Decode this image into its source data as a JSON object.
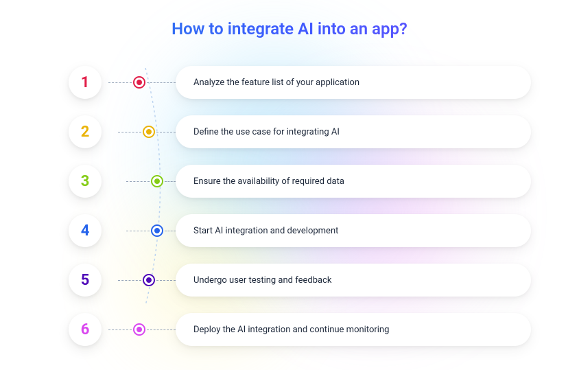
{
  "title": "How to integrate AI into an app?",
  "steps": [
    {
      "num": "1",
      "text": "Analyze the feature list of your application",
      "color": "#e11d48"
    },
    {
      "num": "2",
      "text": "Define the use case for integrating AI",
      "color": "#eab308"
    },
    {
      "num": "3",
      "text": "Ensure the availability of required data",
      "color": "#84cc16"
    },
    {
      "num": "4",
      "text": "Start AI integration and development",
      "color": "#2563eb"
    },
    {
      "num": "5",
      "text": "Undergo user testing and feedback",
      "color": "#4f0ab8"
    },
    {
      "num": "6",
      "text": "Deploy the AI integration and continue monitoring",
      "color": "#d946ef"
    }
  ]
}
